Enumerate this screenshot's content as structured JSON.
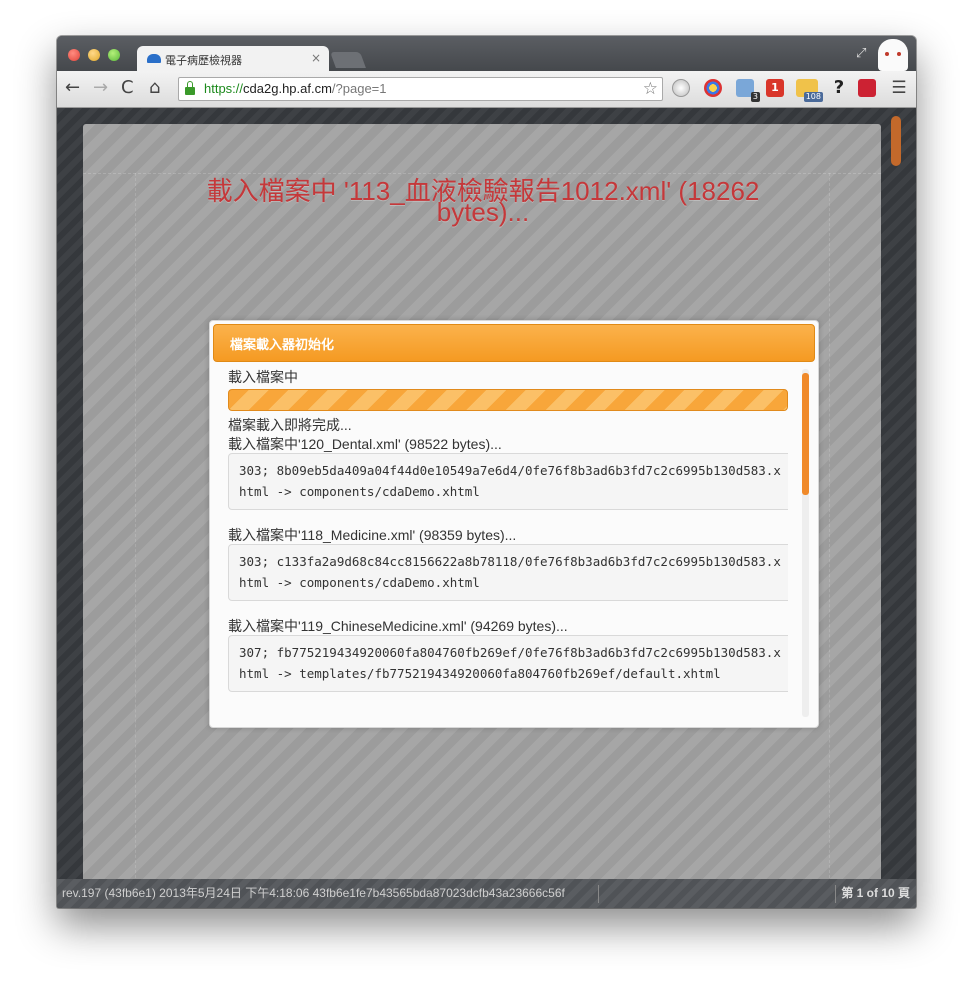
{
  "browser": {
    "tab_title": "電子病歷檢視器",
    "tab_close": "×",
    "url": {
      "scheme": "https://",
      "host": "cda2g.hp.af.cm",
      "path": "/?page=1"
    },
    "nav": {
      "back": "←",
      "forward": "→",
      "reload": "C",
      "home": "⌂",
      "star": "☆",
      "menu": "☰"
    },
    "extensions": [
      {
        "name": "globe-icon"
      },
      {
        "name": "chrome-extension-icon"
      },
      {
        "name": "tool-icon",
        "badge": "3"
      },
      {
        "name": "one-icon",
        "label": "1"
      },
      {
        "name": "user-icon",
        "badge": "108"
      },
      {
        "name": "help-icon",
        "label": "?"
      },
      {
        "name": "camera-icon"
      }
    ]
  },
  "page": {
    "heading": "載入檔案中 '113_血液檢驗報告1012.xml' (18262 bytes)..."
  },
  "dialog": {
    "title": "檔案載入器初始化",
    "loading_label": "載入檔案中",
    "progress_percent": 100,
    "ready_text": "檔案載入即將完成...",
    "entries": [
      {
        "file_line": "載入檔案中'120_Dental.xml' (98522 bytes)...",
        "log": "303; 8b09eb5da409a04f44d0e10549a7e6d4/0fe76f8b3ad6b3fd7c2c6995b130d583.xhtml -> components/cdaDemo.xhtml"
      },
      {
        "file_line": "載入檔案中'118_Medicine.xml' (98359 bytes)...",
        "log": "303; c133fa2a9d68c84cc8156622a8b78118/0fe76f8b3ad6b3fd7c2c6995b130d583.xhtml -> components/cdaDemo.xhtml"
      },
      {
        "file_line": "載入檔案中'119_ChineseMedicine.xml' (94269 bytes)...",
        "log": "307; fb775219434920060fa804760fb269ef/0fe76f8b3ad6b3fd7c2c6995b130d583.xhtml -> templates/fb775219434920060fa804760fb269ef/default.xhtml"
      }
    ]
  },
  "footer": {
    "rev": "rev.197 (43fb6e1) 2013年5月24日 下午4:18:06 43fb6e1fe7b43565bda87023dcfb43a23666c56f",
    "pager": "第 1 of 10 頁"
  },
  "colors": {
    "accent_orange": "#f59a22",
    "heading_red": "#c5383a"
  }
}
